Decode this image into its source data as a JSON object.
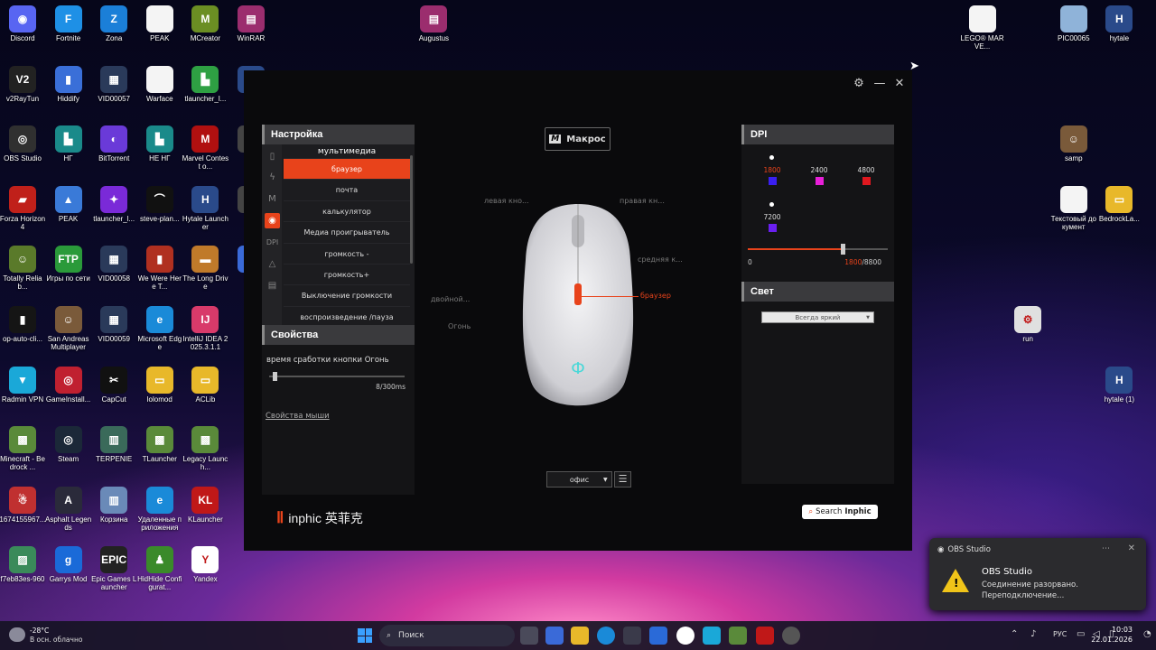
{
  "desktop": {
    "icons": [
      {
        "label": "Discord",
        "color": "#5865f2",
        "glyph": "◉"
      },
      {
        "label": "Fortnite",
        "color": "#1e90e6",
        "glyph": "F"
      },
      {
        "label": "Zona",
        "color": "#1b7fd8",
        "glyph": "Z"
      },
      {
        "label": "PEAK",
        "color": "#f4f4f4",
        "glyph": ""
      },
      {
        "label": "MCreator",
        "color": "#6b8e23",
        "glyph": "M"
      },
      {
        "label": "WinRAR",
        "color": "#9b2d6e",
        "glyph": "▤"
      },
      {
        "label": "Augustus",
        "color": "#9b2d6e",
        "glyph": "▤"
      },
      {
        "label": "LEGO® MARVE...",
        "color": "#f4f4f4",
        "glyph": ""
      },
      {
        "label": "PIC00065",
        "color": "#8fb3d9",
        "glyph": ""
      },
      {
        "label": "hytale",
        "color": "#2a4a8a",
        "glyph": "H"
      },
      {
        "label": "v2RayTun",
        "color": "#222",
        "glyph": "V2"
      },
      {
        "label": "Hiddify",
        "color": "#3a6fd8",
        "glyph": "▮"
      },
      {
        "label": "VID00057",
        "color": "#2a3a5a",
        "glyph": "▦"
      },
      {
        "label": "Warface",
        "color": "#f4f4f4",
        "glyph": ""
      },
      {
        "label": "tlauncher_l...",
        "color": "#2ea043",
        "glyph": "▙"
      },
      {
        "label": "hyt",
        "color": "#2a4a8a",
        "glyph": "H"
      },
      {
        "label": "OBS Studio",
        "color": "#303030",
        "glyph": "◎"
      },
      {
        "label": "НГ",
        "color": "#1a8a8a",
        "glyph": "▙"
      },
      {
        "label": "BitTorrent",
        "color": "#6a3ad8",
        "glyph": "◐"
      },
      {
        "label": "НЕ НГ",
        "color": "#1a8a8a",
        "glyph": "▙"
      },
      {
        "label": "Marvel Contest o...",
        "color": "#b01010",
        "glyph": "M"
      },
      {
        "label": "Wi",
        "color": "#444",
        "glyph": "W"
      },
      {
        "label": "samp",
        "color": "#7a5a3a",
        "glyph": "☺"
      },
      {
        "label": "Forza Horizon 4",
        "color": "#c0201a",
        "glyph": "▰"
      },
      {
        "label": "PEAK",
        "color": "#3a7ad8",
        "glyph": "▲"
      },
      {
        "label": "tlauncher_l...",
        "color": "#7a2ad8",
        "glyph": "✦"
      },
      {
        "label": "steve-plan...",
        "color": "#111",
        "glyph": "⌒"
      },
      {
        "label": "Hytale Launcher",
        "color": "#2a4a8a",
        "glyph": "H"
      },
      {
        "label": "И",
        "color": "#444",
        "glyph": "И"
      },
      {
        "label": "Текстовый документ",
        "color": "#f4f4f4",
        "glyph": ""
      },
      {
        "label": "BedrockLa...",
        "color": "#e8b82a",
        "glyph": "▭"
      },
      {
        "label": "Totally Reliab...",
        "color": "#5a7a2a",
        "glyph": "☺"
      },
      {
        "label": "Игры по сети",
        "color": "#2a9a3a",
        "glyph": "FTP"
      },
      {
        "label": "VID00058",
        "color": "#2a3a5a",
        "glyph": "▦"
      },
      {
        "label": "We Were Here T...",
        "color": "#b03020",
        "glyph": "▮"
      },
      {
        "label": "The Long Drive",
        "color": "#c07a2a",
        "glyph": "▬"
      },
      {
        "label": "Bou",
        "color": "#3a6ad8",
        "glyph": "B"
      },
      {
        "label": "op-auto-cli...",
        "color": "#151515",
        "glyph": "▮"
      },
      {
        "label": "San Andreas Multiplayer",
        "color": "#7a5a3a",
        "glyph": "☺"
      },
      {
        "label": "VID00059",
        "color": "#2a3a5a",
        "glyph": "▦"
      },
      {
        "label": "Microsoft Edge",
        "color": "#1a8ad8",
        "glyph": "e"
      },
      {
        "label": "IntelliJ IDEA 2025.3.1.1",
        "color": "#d83a6a",
        "glyph": "IJ"
      },
      {
        "label": "run",
        "color": "#e0e0e0",
        "glyph": "⚙"
      },
      {
        "label": "Radmin VPN",
        "color": "#1aa8d8",
        "glyph": "▼"
      },
      {
        "label": "GameInstall...",
        "color": "#c02030",
        "glyph": "◎"
      },
      {
        "label": "CapCut",
        "color": "#111",
        "glyph": "✂"
      },
      {
        "label": "lolomod",
        "color": "#e8b82a",
        "glyph": "▭"
      },
      {
        "label": "ACLib",
        "color": "#e8b82a",
        "glyph": "▭"
      },
      {
        "label": "hytale (1)",
        "color": "#2a4a8a",
        "glyph": "H"
      },
      {
        "label": "Minecraft - Bedrock ...",
        "color": "#5a8a3a",
        "glyph": "▩"
      },
      {
        "label": "Steam",
        "color": "#1b2838",
        "glyph": "◎"
      },
      {
        "label": "TERPENIE",
        "color": "#3a6a5a",
        "glyph": "▥"
      },
      {
        "label": "TLauncher",
        "color": "#5a8a3a",
        "glyph": "▩"
      },
      {
        "label": "Legacy Launch...",
        "color": "#5a8a3a",
        "glyph": "▩"
      },
      {
        "label": "1674155967...",
        "color": "#c03030",
        "glyph": "☃"
      },
      {
        "label": "Asphalt Legends",
        "color": "#2a2a3a",
        "glyph": "A"
      },
      {
        "label": "Корзина",
        "color": "#6a8ab8",
        "glyph": "▥"
      },
      {
        "label": "Удаленные приложения",
        "color": "#1a8ad8",
        "glyph": "e"
      },
      {
        "label": "KLauncher",
        "color": "#c01818",
        "glyph": "KL"
      },
      {
        "label": "f7eb83es-960",
        "color": "#3a8a5a",
        "glyph": "▨"
      },
      {
        "label": "Garrys Mod",
        "color": "#1a6ad8",
        "glyph": "g"
      },
      {
        "label": "Epic Games Launcher",
        "color": "#222",
        "glyph": "EPIC"
      },
      {
        "label": "HidHide Configurat...",
        "color": "#3a8a2a",
        "glyph": "♟"
      },
      {
        "label": "Yandex",
        "color": "#fff",
        "glyph": "Y"
      }
    ]
  },
  "app": {
    "title_icons": {
      "settings": "gear-icon",
      "minimize": "minimize-icon",
      "close": "close-icon"
    },
    "settings_panel": {
      "title": "Настройка",
      "category": "мультимедиа",
      "items": [
        "браузер",
        "почта",
        "калькулятор",
        "Медиа проигрыватель",
        "громкость -",
        "громкость+",
        "Выключение громкости",
        "воспроизведение /пауза"
      ],
      "selected_index": 0,
      "side_tabs": [
        "mouse-icon",
        "lightning-icon",
        "macro-m-icon",
        "multimedia-icon",
        "DPI",
        "light-icon",
        "keyboard-icon"
      ]
    },
    "properties_panel": {
      "title": "Свойства",
      "label": "время сработки кнопки Огонь",
      "value": "8/300ms",
      "value_fraction": 0.027,
      "link": "Свойства мыши"
    },
    "macro_button": {
      "icon": "M",
      "label": "Макрос"
    },
    "mouse_callouts": {
      "left": "левая кно...",
      "right": "правая кн...",
      "middle": "средняя к...",
      "double": "двойной...",
      "fire": "Огонь",
      "browser": "браузер"
    },
    "profile_select": {
      "value": "офис"
    },
    "dpi_panel": {
      "title": "DPI",
      "levels": [
        {
          "value": "1800",
          "color": "#3a1ff0",
          "active": true,
          "selected": true
        },
        {
          "value": "2400",
          "color": "#e81fd8",
          "active": false,
          "selected": false
        },
        {
          "value": "4800",
          "color": "#e0181f",
          "active": false,
          "selected": false
        },
        {
          "value": "7200",
          "color": "#6a1ff0",
          "active": true,
          "selected": false
        }
      ],
      "slider_min": "0",
      "slider_current": "1800",
      "slider_max": "8800",
      "slider_fraction": 0.205
    },
    "light_panel": {
      "title": "Свет",
      "mode": "Всегда яркий"
    },
    "brand": {
      "logo": "inphic 英菲克",
      "search": "Search",
      "search_brand": "Inphic"
    }
  },
  "notification": {
    "app": "OBS Studio",
    "title": "OBS Studio",
    "message": "Соединение разорвано. Переподключение..."
  },
  "taskbar": {
    "weather_temp": "-28°C",
    "weather_desc": "В осн. облачно",
    "search": "Поиск",
    "lang": "РУС",
    "time": "10:03",
    "date": "22.01.2026"
  }
}
